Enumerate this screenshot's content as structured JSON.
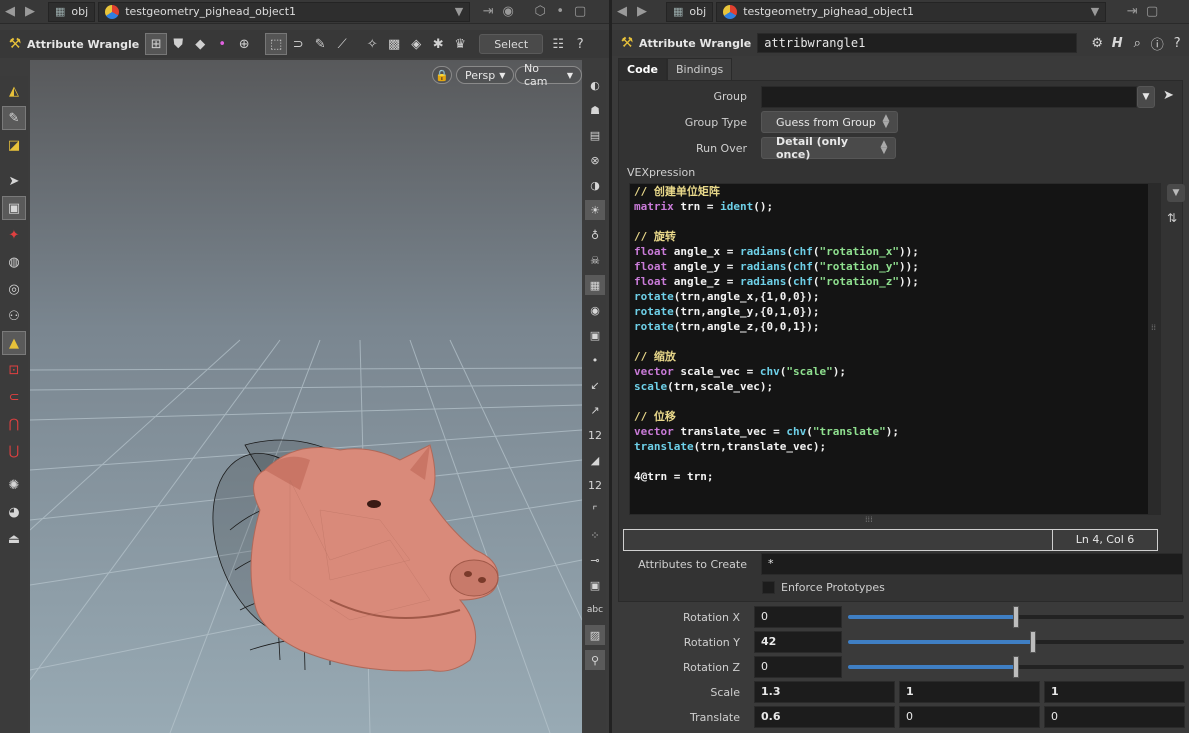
{
  "viewer": {
    "path_root": "obj",
    "path_node": "testgeometry_pighead_object1",
    "tool_title": "Attribute Wrangle",
    "select_label": "Select",
    "persp_label": "Persp",
    "cam_label": "No cam",
    "right_tool_labels": [
      "12",
      "12",
      "abc"
    ]
  },
  "params": {
    "path_root": "obj",
    "path_node": "testgeometry_pighead_object1",
    "node_type": "Attribute Wrangle",
    "node_name": "attribwrangle1",
    "tabs": [
      "Code",
      "Bindings"
    ],
    "group_label": "Group",
    "group_value": "",
    "group_type_label": "Group Type",
    "group_type_value": "Guess from Group",
    "run_over_label": "Run Over",
    "run_over_value": "Detail (only once)",
    "vex_label": "VEXpression",
    "code_lines": [
      "// 创建单位矩阵",
      "matrix trn = ident();",
      "",
      "// 旋转",
      "float angle_x = radians(chf(\"rotation_x\"));",
      "float angle_y = radians(chf(\"rotation_y\"));",
      "float angle_z = radians(chf(\"rotation_z\"));",
      "rotate(trn,angle_x,{1,0,0});",
      "rotate(trn,angle_y,{0,1,0});",
      "rotate(trn,angle_z,{0,0,1});",
      "",
      "// 缩放",
      "vector scale_vec = chv(\"scale\");",
      "scale(trn,scale_vec);",
      "",
      "// 位移",
      "vector translate_vec = chv(\"translate\");",
      "translate(trn,translate_vec);",
      "",
      "4@trn = trn;"
    ],
    "cursor_pos": "Ln 4, Col 6",
    "attrs_label": "Attributes to Create",
    "attrs_value": "*",
    "enforce_label": "Enforce Prototypes",
    "rot_x_label": "Rotation X",
    "rot_x_value": "0",
    "rot_x_level": 0.5,
    "rot_y_label": "Rotation Y",
    "rot_y_value": "42",
    "rot_y_level": 0.55,
    "rot_z_label": "Rotation Z",
    "rot_z_value": "0",
    "rot_z_level": 0.5,
    "scale_label": "Scale",
    "scale_values": [
      "1.3",
      "1",
      "1"
    ],
    "translate_label": "Translate",
    "translate_values": [
      "0.6",
      "0",
      "0"
    ]
  },
  "colors": {
    "accent": "#3f7fc4",
    "comment": "#e8d88a",
    "function": "#6ed0e8",
    "string": "#8fe08f",
    "type": "#c97bd8",
    "pig_skin": "#d98a7a"
  }
}
